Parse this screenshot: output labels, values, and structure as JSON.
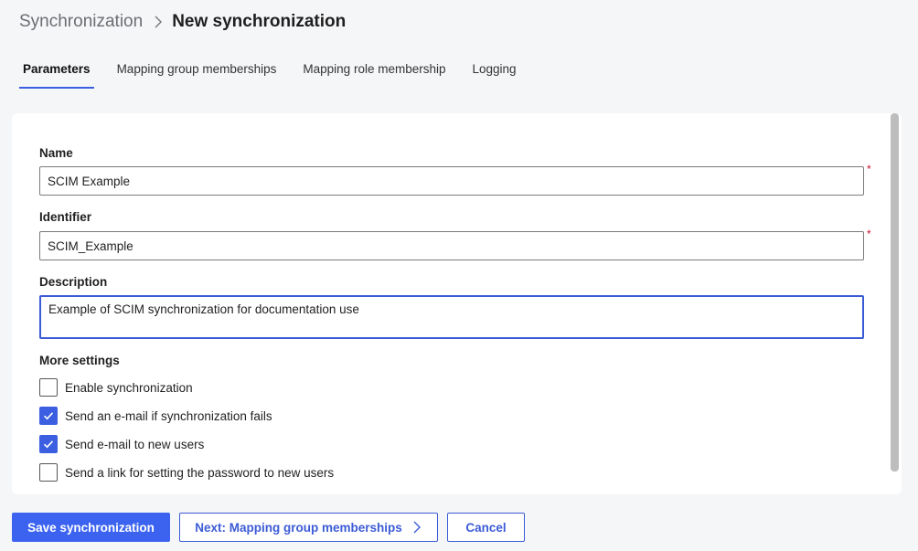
{
  "breadcrumb": {
    "parent": "Synchronization",
    "current": "New synchronization",
    "separator_icon": "chevron-right-icon"
  },
  "tabs": [
    {
      "label": "Parameters",
      "active": true
    },
    {
      "label": "Mapping group memberships",
      "active": false
    },
    {
      "label": "Mapping role membership",
      "active": false
    },
    {
      "label": "Logging",
      "active": false
    }
  ],
  "form": {
    "name": {
      "label": "Name",
      "value": "SCIM Example",
      "required": true,
      "required_mark": "*"
    },
    "identifier": {
      "label": "Identifier",
      "value": "SCIM_Example",
      "required": true,
      "required_mark": "*"
    },
    "description": {
      "label": "Description",
      "value": "Example of SCIM synchronization for documentation use"
    },
    "more_settings": {
      "label": "More settings",
      "options": [
        {
          "label": "Enable synchronization",
          "checked": false
        },
        {
          "label": "Send an e-mail if synchronization fails",
          "checked": true
        },
        {
          "label": "Send e-mail to new users",
          "checked": true
        },
        {
          "label": "Send a link for setting the password to new users",
          "checked": false
        }
      ]
    }
  },
  "footer": {
    "save_label": "Save synchronization",
    "next_label": "Next: Mapping group memberships",
    "next_icon": "chevron-right-icon",
    "cancel_label": "Cancel"
  },
  "colors": {
    "accent": "#3b63f0",
    "required": "#c8102e",
    "background": "#f5f6f8"
  }
}
